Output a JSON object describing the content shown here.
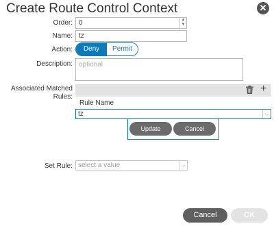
{
  "dialog": {
    "title": "Create Route Control Context",
    "close_glyph": "✕"
  },
  "form": {
    "order": {
      "label": "Order:",
      "value": "0"
    },
    "name": {
      "label": "Name:",
      "value": "tz"
    },
    "action": {
      "label": "Action:",
      "options": [
        "Deny",
        "Permit"
      ],
      "selected": "Deny"
    },
    "description": {
      "label": "Description:",
      "placeholder": "optional"
    },
    "associated_rules": {
      "label_line1": "Associated Matched",
      "label_line2": "Rules:",
      "column_header": "Rule Name",
      "current_value": "tz",
      "update_label": "Update",
      "cancel_label": "Cancel"
    },
    "set_rule": {
      "label": "Set Rule:",
      "placeholder": "select a value"
    }
  },
  "footer": {
    "cancel_label": "Cancel",
    "ok_label": "OK"
  },
  "icons": {
    "trash": "trash-icon",
    "add": "plus-icon",
    "dropdown": "chevron-down-icon"
  },
  "colors": {
    "accent": "#0a7ab8",
    "button_dark": "#5f5f5f",
    "button_disabled": "#e3e3e3"
  }
}
